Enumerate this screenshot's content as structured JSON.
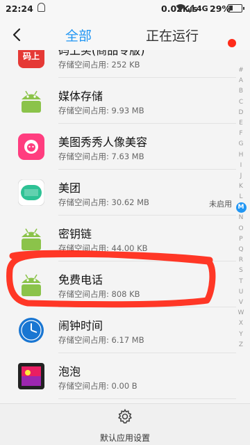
{
  "status_bar": {
    "time": "22:24",
    "speed": "0.02K/s",
    "network": "4G",
    "battery_pct": "29%",
    "battery_level": 0.29
  },
  "header": {
    "tab_all": "全部",
    "tab_running": "正在运行"
  },
  "apps": [
    {
      "name": "码上买(商品专版)",
      "size": "存储空间占用:  252 KB",
      "status": "",
      "icon": "mashangmai-icon"
    },
    {
      "name": "媒体存储",
      "size": "存储空间占用:  9.93 MB",
      "status": "",
      "icon": "android-icon"
    },
    {
      "name": "美图秀秀人像美容",
      "size": "存储空间占用:  7.63 MB",
      "status": "",
      "icon": "meitu-icon"
    },
    {
      "name": "美团",
      "size": "存储空间占用:  30.62 MB",
      "status": "未启用",
      "icon": "meituan-icon"
    },
    {
      "name": "密钥链",
      "size": "存储空间占用:  44.00 KB",
      "status": "",
      "icon": "android-icon"
    },
    {
      "name": "免费电话",
      "size": "存储空间占用:  808 KB",
      "status": "",
      "icon": "android-icon"
    },
    {
      "name": "闹钟时间",
      "size": "存储空间占用:  6.17 MB",
      "status": "",
      "icon": "clock-icon"
    },
    {
      "name": "泡泡",
      "size": "存储空间占用:  0.00 B",
      "status": "",
      "icon": "paopao-icon"
    },
    {
      "name": "",
      "size": "",
      "status": "",
      "icon": "green-app-icon"
    }
  ],
  "index_letters": [
    "#",
    "A",
    "B",
    "C",
    "D",
    "E",
    "F",
    "G",
    "H",
    "I",
    "J",
    "K",
    "L",
    "M",
    "N",
    "O",
    "P",
    "Q",
    "R",
    "S",
    "T",
    "U",
    "V",
    "W",
    "X",
    "Y",
    "Z"
  ],
  "active_letter": "M",
  "bottom": {
    "settings_label": "默认应用设置"
  },
  "colors": {
    "accent": "#2196f3",
    "android_green": "#8bc34a",
    "annotation_red": "#ff2c1a",
    "meitu_pink": "#ff3d7f",
    "meituan_green": "#2ec295"
  }
}
